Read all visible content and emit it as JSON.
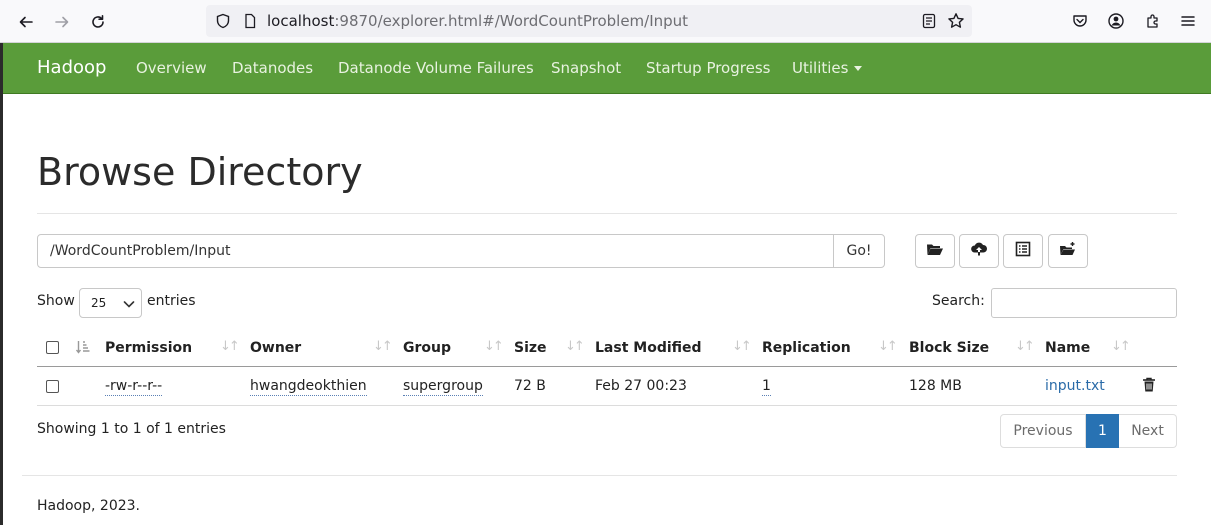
{
  "browser": {
    "url_host": "localhost",
    "url_rest": ":9870/explorer.html#/WordCountProblem/Input"
  },
  "navbar": {
    "brand": "Hadoop",
    "items": [
      "Overview",
      "Datanodes",
      "Datanode Volume Failures",
      "Snapshot",
      "Startup Progress",
      "Utilities"
    ]
  },
  "page": {
    "title": "Browse Directory",
    "path_value": "/WordCountProblem/Input",
    "go_label": "Go!",
    "show_label": "Show",
    "entries_value": "25",
    "entries_label": "entries",
    "search_label": "Search:"
  },
  "table": {
    "columns": [
      "Permission",
      "Owner",
      "Group",
      "Size",
      "Last Modified",
      "Replication",
      "Block Size",
      "Name"
    ],
    "rows": [
      {
        "permission": "-rw-r--r--",
        "owner": "hwangdeokthien",
        "group": "supergroup",
        "size": "72 B",
        "last_modified": "Feb 27 00:23",
        "replication": "1",
        "block_size": "128 MB",
        "name": "input.txt"
      }
    ]
  },
  "pagination": {
    "info": "Showing 1 to 1 of 1 entries",
    "previous": "Previous",
    "current": "1",
    "next": "Next"
  },
  "footer": {
    "text": "Hadoop, 2023."
  },
  "colors": {
    "navbar": "#5a9c3a",
    "link": "#2a6ba8",
    "active_page": "#2872b3"
  }
}
